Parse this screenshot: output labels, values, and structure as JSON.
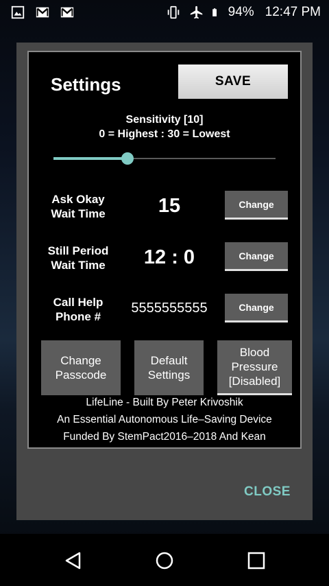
{
  "status_bar": {
    "battery": "94%",
    "time": "12:47 PM",
    "left_icons": [
      "gallery-icon",
      "gmail-icon",
      "gmail-icon"
    ],
    "right_icons": [
      "vibrate-icon",
      "airplane-icon",
      "battery-icon"
    ]
  },
  "dialog": {
    "title": "Settings",
    "save_label": "SAVE",
    "sensitivity": {
      "label": "Sensitivity [10]",
      "range_text": "0 = Highest : 30 = Lowest",
      "value": 10,
      "min": 0,
      "max": 30
    },
    "rows": [
      {
        "label_line1": "Ask Okay",
        "label_line2": "Wait Time",
        "value": "15",
        "button": "Change"
      },
      {
        "label_line1": "Still Period",
        "label_line2": "Wait Time",
        "value": "12 : 0",
        "button": "Change"
      },
      {
        "label_line1": "Call Help",
        "label_line2": "Phone #",
        "value": "5555555555",
        "button": "Change"
      }
    ],
    "actions": {
      "change_passcode": [
        "Change",
        "Passcode"
      ],
      "default_settings": [
        "Default",
        "Settings"
      ],
      "blood_pressure": [
        "Blood",
        "Pressure",
        "[Disabled]"
      ]
    },
    "footer": [
      "LifeLine - Built By Peter Krivoshik",
      "An Essential Autonomous Life–Saving Device",
      "Funded By StemPact2016–2018 And Kean"
    ],
    "close_label": "CLOSE"
  },
  "colors": {
    "accent": "#80cbc4",
    "dialog_bg": "#474747",
    "panel_bg": "#000000",
    "button_bg": "#5c5c5c"
  }
}
